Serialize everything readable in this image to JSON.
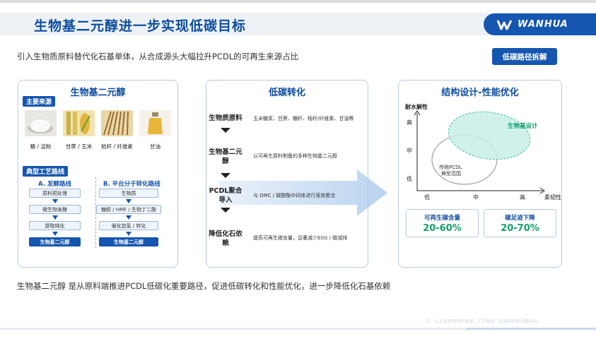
{
  "header": {
    "title": "生物基二元醇进一步实现低碳目标",
    "logo_text": "WANHUA",
    "subtitle": "引入生物质原料替代化石基单体，从合成源头大幅拉升PCDL的可再生来源占比",
    "action_button": "低碳路径拆解"
  },
  "panel_left": {
    "title": "生物基二元醇",
    "sources_tag": "主要来源",
    "materials": [
      {
        "label": "糖 / 淀粉",
        "color": "#efefef"
      },
      {
        "label": "甘蔗 / 玉米",
        "color": "#c9a74a"
      },
      {
        "label": "秸秆 / 纤维素",
        "color": "#b08a4a"
      },
      {
        "label": "甘油",
        "color": "#e8b84a"
      }
    ],
    "process_tag": "典型工艺路线",
    "route_a": {
      "title": "A. 发酵路线",
      "steps": [
        "原料预处理",
        "微生物发酵",
        "提取纯化",
        "生物基二元醇"
      ]
    },
    "route_b": {
      "title": "B. 平台分子转化路线",
      "steps": [
        "生物质",
        "糖醇 / HMF / 生物丁二酸",
        "催化加氢 / 转化",
        "生物基二元醇"
      ]
    }
  },
  "panel_mid": {
    "title": "低碳转化",
    "stages": [
      {
        "label": "生物质原料",
        "desc": "玉米糖浆、甘蔗、糖秆、秸秆/纤维素、甘油等"
      },
      {
        "label": "生物基二元醇",
        "desc": "以可再生原料制备的多种生物基二元醇"
      },
      {
        "label": "PCDL聚合导入",
        "desc": "与 DMC / 碳酸酯中间体进行竞效聚合"
      },
      {
        "label": "降低化石依赖",
        "desc": "提高可再生碳含量，显著减少ESG / 碳减排"
      }
    ]
  },
  "panel_right": {
    "title": "结构设计-性能优化",
    "chart_data": {
      "type": "scatter",
      "ylabel": "耐水解性",
      "xlabel": "柔韧性",
      "x_ticks": [
        "低",
        "中",
        "高"
      ],
      "y_ticks": [
        "高",
        "中",
        "低"
      ],
      "regions": [
        {
          "name": "生物基设计",
          "x_level": "中-高",
          "y_level": "中-高",
          "color": "#c8efe6"
        },
        {
          "name": "传统PCDL 典型范围",
          "x_level": "低-中",
          "y_level": "低-中",
          "color": "#ffffff"
        }
      ]
    },
    "metrics": [
      {
        "label": "可再生碳含量",
        "value": "20-60%"
      },
      {
        "label": "碳足迹下降",
        "value": "20-70%"
      }
    ]
  },
  "footer": {
    "summary": "生物基二元醇 是从原料端推进PCDL低碳化重要路径，促进低碳转化和性能优化，进一步降低化石基依赖",
    "footnote": "注：LCA 结果受原料来源、工艺路线、能源结构等因素影响。"
  },
  "colors": {
    "brand": "#1556b0",
    "accent_green": "#14a06a",
    "title_blue": "#0d4da1"
  }
}
